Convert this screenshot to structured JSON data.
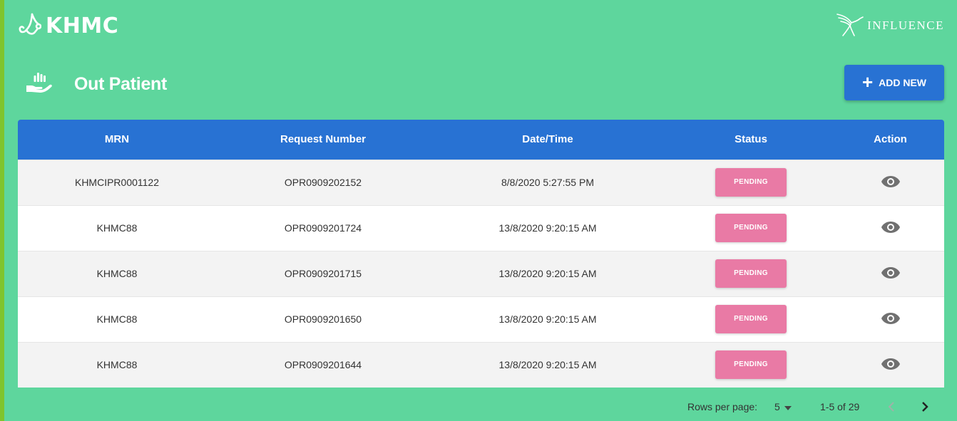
{
  "header": {
    "brand": "KHMC",
    "partner": "INFLUENCE"
  },
  "page": {
    "title": "Out Patient",
    "add_button": "ADD NEW"
  },
  "table": {
    "columns": [
      "MRN",
      "Request Number",
      "Date/Time",
      "Status",
      "Action"
    ],
    "rows": [
      {
        "mrn": "KHMCIPR0001122",
        "request": "OPR0909202152",
        "datetime": "8/8/2020 5:27:55 PM",
        "status": "PENDING"
      },
      {
        "mrn": "KHMC88",
        "request": "OPR0909201724",
        "datetime": "13/8/2020 9:20:15 AM",
        "status": "PENDING"
      },
      {
        "mrn": "KHMC88",
        "request": "OPR0909201715",
        "datetime": "13/8/2020 9:20:15 AM",
        "status": "PENDING"
      },
      {
        "mrn": "KHMC88",
        "request": "OPR0909201650",
        "datetime": "13/8/2020 9:20:15 AM",
        "status": "PENDING"
      },
      {
        "mrn": "KHMC88",
        "request": "OPR0909201644",
        "datetime": "13/8/2020 9:20:15 AM",
        "status": "PENDING"
      }
    ]
  },
  "pagination": {
    "rows_per_page_label": "Rows per page:",
    "rows_per_page": "5",
    "range": "1-5 of 29"
  },
  "colors": {
    "background": "#5ed69d",
    "header_blue": "#2872d3",
    "pending_pink": "#e97aa5"
  },
  "icons": {
    "brand": "stethoscope-icon",
    "partner": "hummingbird-icon",
    "page": "hand-holding-icon",
    "add": "plus-icon",
    "action": "eye-icon",
    "dropdown": "caret-down-icon",
    "prev": "chevron-left-icon",
    "next": "chevron-right-icon"
  }
}
